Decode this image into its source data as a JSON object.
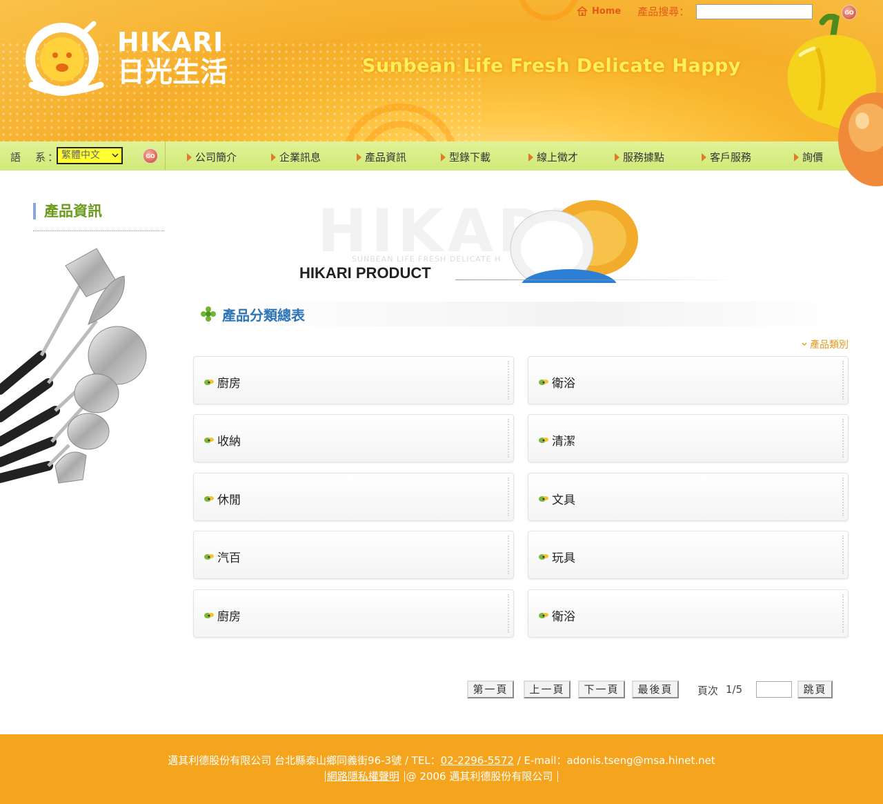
{
  "header": {
    "logo_en": "HIKARI",
    "logo_zh": "日光生活",
    "slogan": "Sunbean Life Fresh Delicate Happy",
    "home_label": "Home",
    "search_label": "產品搜尋：",
    "search_value": "",
    "go_label": "GO"
  },
  "nav": {
    "lang_label": "語　系：",
    "lang_selected": "繁體中文",
    "go_label": "GO",
    "items": [
      {
        "label": "公司簡介"
      },
      {
        "label": "企業訊息"
      },
      {
        "label": "產品資訊"
      },
      {
        "label": "型錄下載"
      },
      {
        "label": "線上徵才"
      },
      {
        "label": "服務據點"
      },
      {
        "label": "客戶服務"
      },
      {
        "label": "詢價"
      }
    ]
  },
  "sidebar": {
    "title": "產品資訊"
  },
  "banner": {
    "bg_text": "HIKARI",
    "sub_text": "SUNBEAN LIFE FRESH DELICATE H",
    "title": "HIKARI PRODUCT"
  },
  "section": {
    "title": "產品分類總表",
    "category_link": "產品類別"
  },
  "categories": [
    {
      "label": "廚房"
    },
    {
      "label": "衛浴"
    },
    {
      "label": "收納"
    },
    {
      "label": "清潔"
    },
    {
      "label": "休閒"
    },
    {
      "label": "文具"
    },
    {
      "label": "汽百"
    },
    {
      "label": "玩具"
    },
    {
      "label": "廚房"
    },
    {
      "label": "衛浴"
    }
  ],
  "pager": {
    "first": "第一頁",
    "prev": "上一頁",
    "next": "下一頁",
    "last": "最後頁",
    "page_label": "頁次",
    "page_value": "1/5",
    "jump_input": "",
    "jump": "跳頁"
  },
  "footer": {
    "company_address": "邁其利德股份有限公司 台北縣泰山鄉同義街96-3號 / TEL：",
    "tel": "02-2296-5572",
    "email_text": " / E-mail：adonis.tseng@msa.hinet.net",
    "privacy": "網路隱私權聲明",
    "copyright": "@ 2006 邁其利德股份有限公司"
  },
  "colors": {
    "header_orange": "#f6ae2a",
    "nav_green": "#d8ed86",
    "footer_orange": "#f5a41d",
    "section_blue": "#2b74b8",
    "sidebar_green": "#6b9a1c"
  }
}
